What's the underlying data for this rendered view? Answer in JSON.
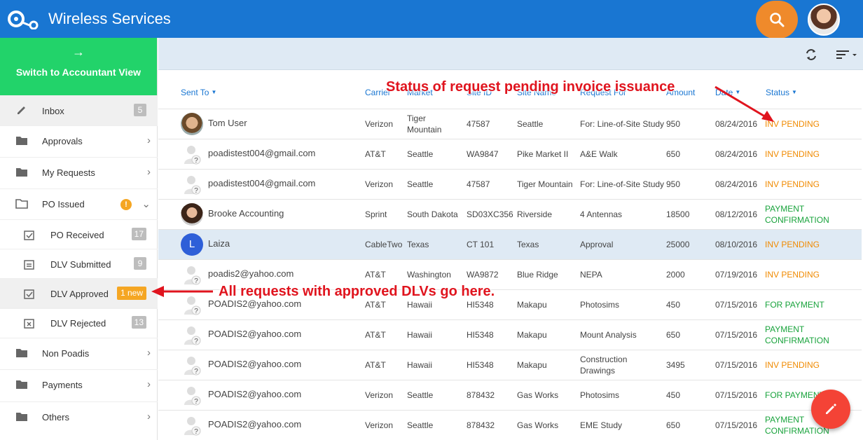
{
  "header": {
    "title": "Wireless Services"
  },
  "sidebar": {
    "switch_arrow": "→",
    "switch_label": "Switch to Accountant View",
    "inbox": {
      "label": "Inbox",
      "count": "5"
    },
    "approvals": {
      "label": "Approvals"
    },
    "my_requests": {
      "label": "My Requests"
    },
    "po_issued": {
      "label": "PO Issued",
      "alert": "!"
    },
    "po_received": {
      "label": "PO Received",
      "count": "17"
    },
    "dlv_submitted": {
      "label": "DLV Submitted",
      "count": "9"
    },
    "dlv_approved": {
      "label": "DLV Approved",
      "badge": "1 new"
    },
    "dlv_rejected": {
      "label": "DLV Rejected",
      "count": "13"
    },
    "non_poadis": {
      "label": "Non Poadis"
    },
    "payments": {
      "label": "Payments"
    },
    "others": {
      "label": "Others"
    }
  },
  "table": {
    "headers": {
      "sent_to": "Sent To",
      "carrier": "Carrier",
      "market": "Market",
      "site_id": "Site ID",
      "site_name": "Site Name",
      "request_for": "Request For",
      "amount": "Amount",
      "date": "Date",
      "status": "Status"
    },
    "rows": [
      {
        "sent_to": "Tom User",
        "carrier": "Verizon",
        "market": "Tiger Mountain",
        "site_id": "47587",
        "site_name": "Seattle",
        "request_for": "For: Line-of-Site Study",
        "amount": "950",
        "date": "08/24/2016",
        "status": "INV PENDING"
      },
      {
        "sent_to": "poadistest004@gmail.com",
        "carrier": "AT&T",
        "market": "Seattle",
        "site_id": "WA9847",
        "site_name": "Pike Market II",
        "request_for": "A&E Walk",
        "amount": "650",
        "date": "08/24/2016",
        "status": "INV PENDING"
      },
      {
        "sent_to": "poadistest004@gmail.com",
        "carrier": "Verizon",
        "market": "Seattle",
        "site_id": "47587",
        "site_name": "Tiger Mountain",
        "request_for": "For: Line-of-Site Study",
        "amount": "950",
        "date": "08/24/2016",
        "status": "INV PENDING"
      },
      {
        "sent_to": "Brooke Accounting",
        "carrier": "Sprint",
        "market": "South Dakota",
        "site_id": "SD03XC356",
        "site_name": "Riverside",
        "request_for": "4 Antennas",
        "amount": "18500",
        "date": "08/12/2016",
        "status": "PAYMENT CONFIRMATION"
      },
      {
        "sent_to": "Laiza",
        "avatar_letter": "L",
        "carrier": "CableTwo",
        "market": "Texas",
        "site_id": "CT 101",
        "site_name": "Texas",
        "request_for": "Approval",
        "amount": "25000",
        "date": "08/10/2016",
        "status": "INV PENDING"
      },
      {
        "sent_to": "poadis2@yahoo.com",
        "carrier": "AT&T",
        "market": "Washington",
        "site_id": "WA9872",
        "site_name": "Blue Ridge",
        "request_for": "NEPA",
        "amount": "2000",
        "date": "07/19/2016",
        "status": "INV PENDING"
      },
      {
        "sent_to": "POADIS2@yahoo.com",
        "carrier": "AT&T",
        "market": "Hawaii",
        "site_id": "HI5348",
        "site_name": "Makapu",
        "request_for": "Photosims",
        "amount": "450",
        "date": "07/15/2016",
        "status": "FOR PAYMENT"
      },
      {
        "sent_to": "POADIS2@yahoo.com",
        "carrier": "AT&T",
        "market": "Hawaii",
        "site_id": "HI5348",
        "site_name": "Makapu",
        "request_for": "Mount Analysis",
        "amount": "650",
        "date": "07/15/2016",
        "status": "PAYMENT CONFIRMATION"
      },
      {
        "sent_to": "POADIS2@yahoo.com",
        "carrier": "AT&T",
        "market": "Hawaii",
        "site_id": "HI5348",
        "site_name": "Makapu",
        "request_for": "Construction Drawings",
        "amount": "3495",
        "date": "07/15/2016",
        "status": "INV PENDING"
      },
      {
        "sent_to": "POADIS2@yahoo.com",
        "carrier": "Verizon",
        "market": "Seattle",
        "site_id": "878432",
        "site_name": "Gas Works",
        "request_for": "Photosims",
        "amount": "450",
        "date": "07/15/2016",
        "status": "FOR PAYMENT"
      },
      {
        "sent_to": "POADIS2@yahoo.com",
        "carrier": "Verizon",
        "market": "Seattle",
        "site_id": "878432",
        "site_name": "Gas Works",
        "request_for": "EME Study",
        "amount": "650",
        "date": "07/15/2016",
        "status": "PAYMENT CONFIRMATION"
      }
    ]
  },
  "annotations": {
    "status_note": "Status of request pending invoice issuance",
    "dlv_note": "All requests with approved DLVs go here."
  },
  "colors": {
    "primary": "#1976d2",
    "switch_green": "#22d36a",
    "search_orange": "#ef8a2b",
    "inv_pending": "#f08a00",
    "payment": "#19a33c",
    "fab": "#f44336",
    "annotation": "#e0141e"
  },
  "icons": {
    "search": "search-icon",
    "refresh": "refresh-icon",
    "sort": "sort-icon",
    "edit": "pencil-icon"
  }
}
